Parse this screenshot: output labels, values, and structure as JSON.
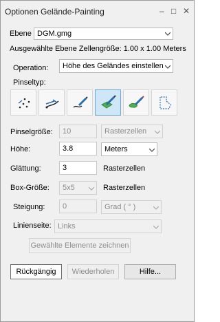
{
  "window": {
    "title": "Optionen Gelände-Painting",
    "controls": {
      "pin": "–",
      "restore": "□",
      "close": "✕"
    }
  },
  "layer": {
    "label": "Ebene",
    "value": "DGM.gmg",
    "cell_size_text": "Ausgewählte Ebene Zellengröße: 1.00 x 1.00 Meters"
  },
  "operation": {
    "label": "Operation:",
    "value": "Höhe des Geländes einstellen"
  },
  "brush_type": {
    "label": "Pinseltyp:",
    "tools": [
      {
        "name": "dots-brush-icon"
      },
      {
        "name": "line-brush-icon"
      },
      {
        "name": "freehand-brush-icon"
      },
      {
        "name": "fill-brush-icon",
        "active": true
      },
      {
        "name": "area-brush-icon"
      },
      {
        "name": "selection-brush-icon"
      }
    ]
  },
  "brush_size": {
    "label": "Pinselgröße:",
    "value": "10",
    "unit": "Rasterzellen"
  },
  "height": {
    "label": "Höhe:",
    "value": "3.8",
    "unit": "Meters"
  },
  "smoothing": {
    "label": "Glättung:",
    "value": "3",
    "unit": "Rasterzellen"
  },
  "box_size": {
    "label": "Box-Größe:",
    "value": "5x5",
    "unit": "Rasterzellen"
  },
  "slope": {
    "label": "Steigung:",
    "value": "0",
    "unit": "Grad ( ° )"
  },
  "line_side": {
    "label": "Linienseite:",
    "value": "Links"
  },
  "draw_selected_button": "Gewählte Elemente zeichnen",
  "buttons": {
    "undo": "Rückgängig",
    "redo": "Wiederholen",
    "help": "Hilfe..."
  },
  "colors": {
    "active_tool": "#cfe6f7",
    "brush_green": "#4caf50"
  }
}
